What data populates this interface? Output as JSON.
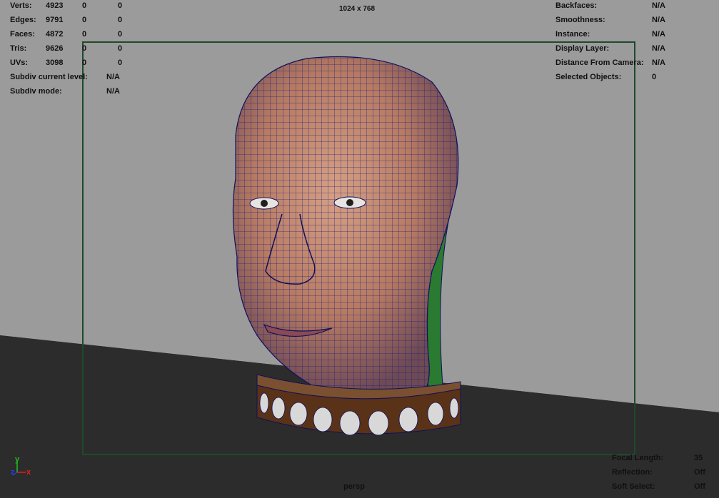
{
  "viewport": {
    "resolution_gate": "1024 x 768",
    "camera": "persp",
    "colors": {
      "wall": "#9a9a9a",
      "floor": "#2b2b2b",
      "gate_border": "#1f4a2a",
      "wireframe": "#1a1a7a",
      "skin": "#c98a6e",
      "collar": "#5a3218"
    }
  },
  "poly_count": {
    "rows": [
      {
        "label": "Verts:",
        "v1": "4923",
        "v2": "0",
        "v3": "0"
      },
      {
        "label": "Edges:",
        "v1": "9791",
        "v2": "0",
        "v3": "0"
      },
      {
        "label": "Faces:",
        "v1": "4872",
        "v2": "0",
        "v3": "0"
      },
      {
        "label": "Tris:",
        "v1": "9626",
        "v2": "0",
        "v3": "0"
      },
      {
        "label": "UVs:",
        "v1": "3098",
        "v2": "0",
        "v3": "0"
      }
    ],
    "subdiv_level_label": "Subdiv current level:",
    "subdiv_level_value": "N/A",
    "subdiv_mode_label": "Subdiv mode:",
    "subdiv_mode_value": "N/A"
  },
  "object_details": {
    "rows": [
      {
        "label": "Backfaces:",
        "value": "N/A"
      },
      {
        "label": "Smoothness:",
        "value": "N/A"
      },
      {
        "label": "Instance:",
        "value": "N/A"
      },
      {
        "label": "Display Layer:",
        "value": "N/A"
      },
      {
        "label": "Distance From Camera:",
        "value": "N/A"
      },
      {
        "label": "Selected Objects:",
        "value": "0"
      }
    ]
  },
  "camera_info": {
    "rows": [
      {
        "label": "Focal Length:",
        "value": "35"
      },
      {
        "label": "Reflection:",
        "value": "Off"
      },
      {
        "label": "Soft Select:",
        "value": "Off"
      }
    ]
  },
  "axis": {
    "y": "y",
    "z": "z",
    "x": "x",
    "colors": {
      "x": "#e02020",
      "y": "#20c020",
      "z": "#2040e0"
    }
  }
}
